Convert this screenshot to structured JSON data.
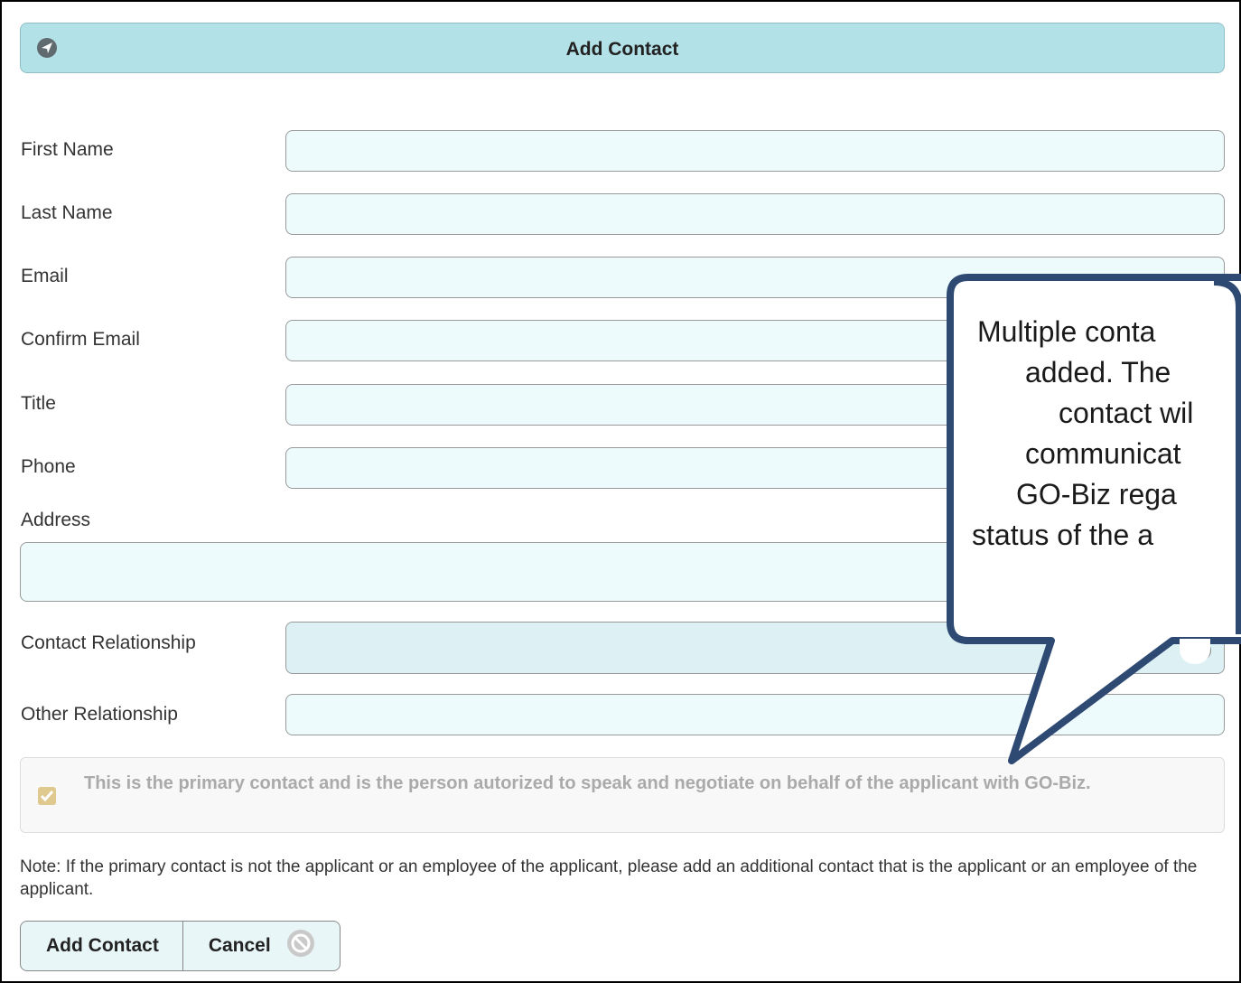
{
  "header": {
    "title": "Add Contact",
    "icon": "navigation-arrow-icon"
  },
  "form": {
    "first_name_label": "First Name",
    "last_name_label": "Last Name",
    "email_label": "Email",
    "confirm_email_label": "Confirm Email",
    "title_label": "Title",
    "phone_label": "Phone",
    "address_label": "Address",
    "contact_relationship_label": "Contact Relationship",
    "other_relationship_label": "Other Relationship"
  },
  "primary_contact": {
    "checked": true,
    "label": "This is the primary contact and is the person autorized to speak and negotiate on behalf of the applicant with GO-Biz."
  },
  "note": "Note: If the primary contact is not the applicant or an employee of the applicant, please add an additional contact that is the applicant or an employee of the applicant.",
  "buttons": {
    "add_contact": "Add Contact",
    "cancel": "Cancel"
  },
  "callout": {
    "lines": [
      "Multiple conta",
      "added.  The",
      "contact wil",
      "communicat",
      "GO-Biz rega",
      "status of the a"
    ]
  },
  "colors": {
    "header_bg": "#b3e1e8",
    "callout_fill": "#ffffff",
    "callout_border": "#2e4a73"
  }
}
